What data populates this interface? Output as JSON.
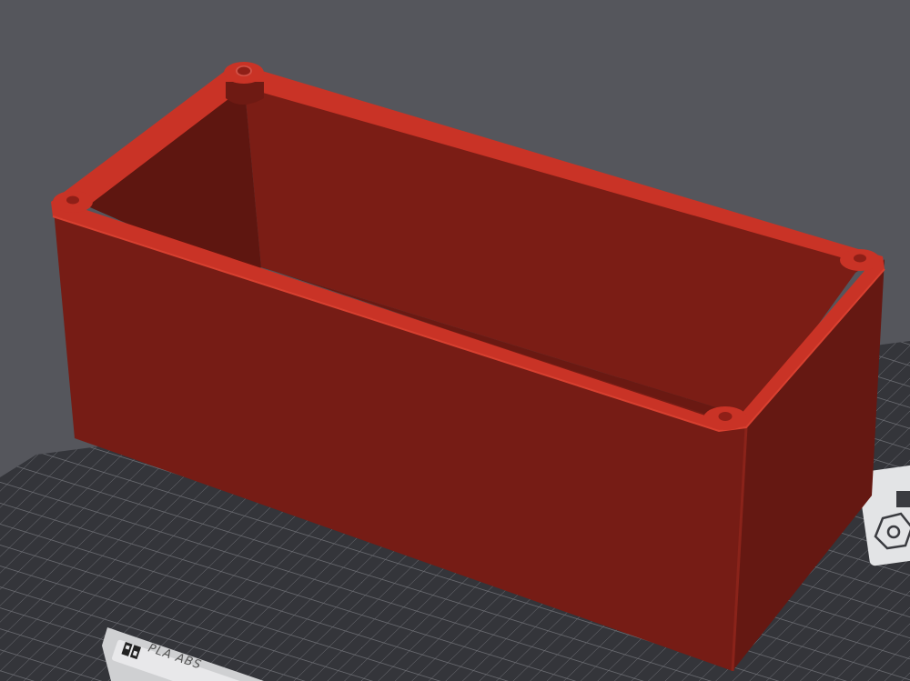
{
  "viewport": {
    "background_color": "#55565c",
    "grid_color": "#6d6e74",
    "plate_color": "#34353a"
  },
  "build_plate": {
    "label_text": "PLA ABS",
    "label_icon": "bambu-logo-icon"
  },
  "model": {
    "color": "#7c1d16",
    "highlight_color": "#c93326",
    "mounting_holes": 4
  },
  "right_toolbar": {
    "items": [
      {
        "icon": "square-icon"
      },
      {
        "icon": "hexagon-nut-icon"
      }
    ]
  }
}
